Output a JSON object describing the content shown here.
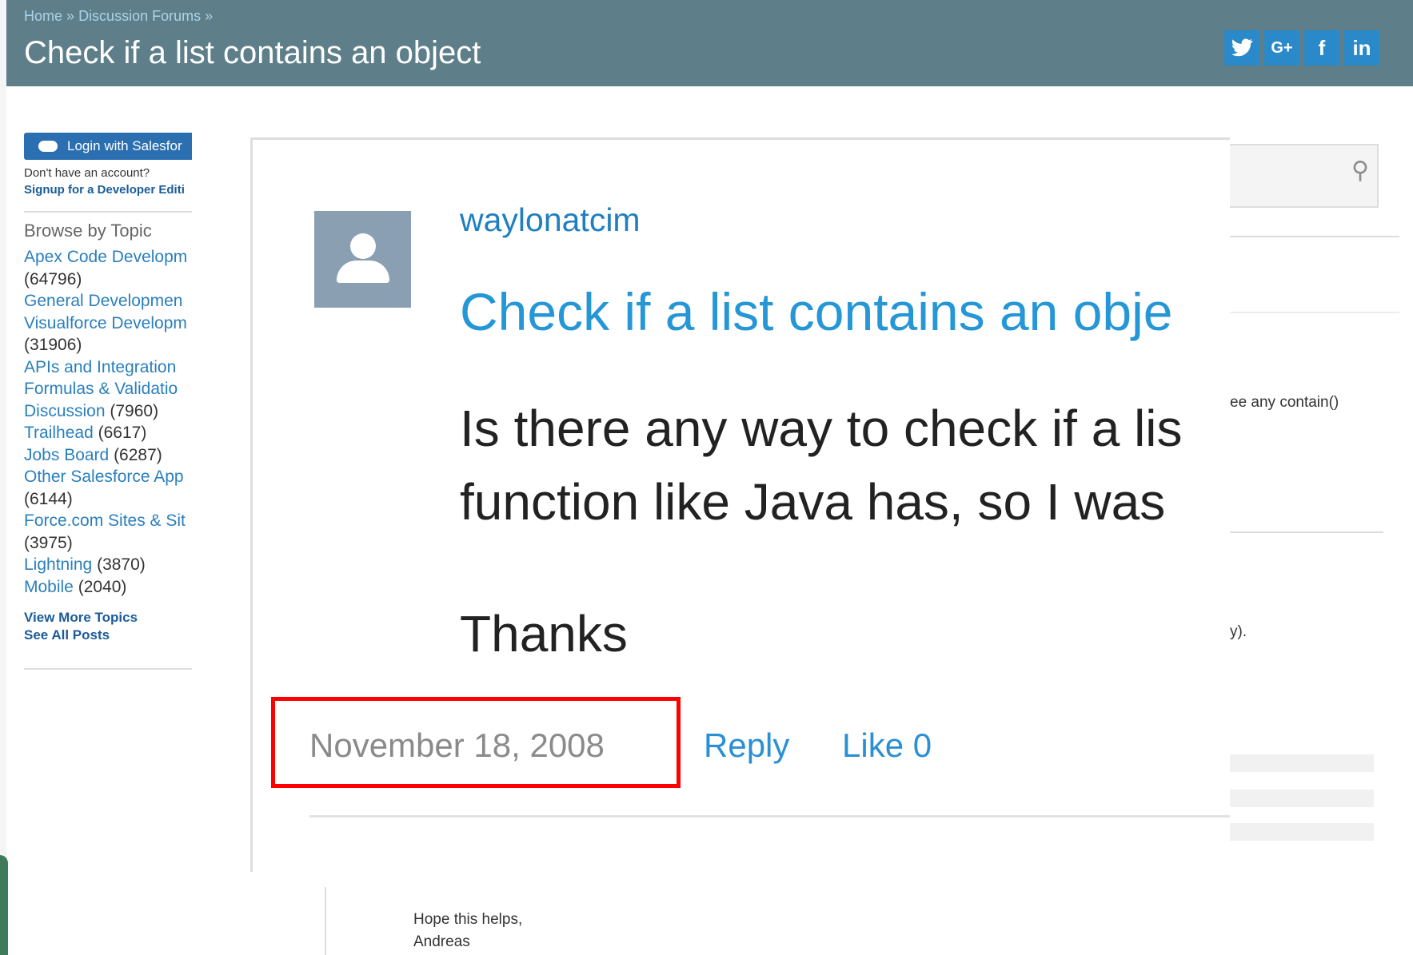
{
  "header": {
    "breadcrumb": [
      "Home",
      "»",
      "Discussion Forums",
      "»"
    ],
    "title": "Check if a list contains an object",
    "social_icons": [
      {
        "name": "twitter-icon",
        "glyph": "🐦"
      },
      {
        "name": "google-plus-icon",
        "glyph": "G+"
      },
      {
        "name": "facebook-icon",
        "glyph": "f"
      },
      {
        "name": "linkedin-icon",
        "glyph": "in"
      }
    ]
  },
  "sidebar": {
    "login_label": "Login with Salesfor",
    "no_account": "Don't have an account?",
    "signup": "Signup for a Developer Editi",
    "browse_title": "Browse by Topic",
    "topic_lines": [
      {
        "name": "Apex Code Developm",
        "count": ""
      },
      {
        "name": "",
        "count": "(64796)"
      },
      {
        "name": "General Developmen",
        "count": ""
      },
      {
        "name": "Visualforce Developm",
        "count": ""
      },
      {
        "name": "",
        "count": "(31906)"
      },
      {
        "name": "APIs and Integration",
        "count": ""
      },
      {
        "name": "Formulas & Validatio",
        "count": ""
      },
      {
        "name": "Discussion",
        "count": " (7960)"
      },
      {
        "name": "Trailhead",
        "count": " (6617)"
      },
      {
        "name": "Jobs Board",
        "count": " (6287)"
      },
      {
        "name": "Other Salesforce App",
        "count": ""
      },
      {
        "name": "",
        "count": "(6144)"
      },
      {
        "name": "Force.com Sites & Sit",
        "count": ""
      },
      {
        "name": "",
        "count": "(3975)"
      },
      {
        "name": "Lightning",
        "count": " (3870)"
      },
      {
        "name": "Mobile",
        "count": " (2040)"
      }
    ],
    "view_more": "View More Topics",
    "see_all": "See All Posts"
  },
  "main": {
    "side_text_1": "ee any contain()",
    "side_text_2": "y).",
    "footer_line_1": "Hope this helps,",
    "footer_line_2": "Andreas"
  },
  "post": {
    "username": "waylonatcim",
    "title": "Check if a list contains an obje",
    "body_line_1": "Is there any way to check if a lis",
    "body_line_2": "function like Java has, so I was",
    "thanks": "Thanks",
    "date": "November 18, 2008",
    "reply": "Reply",
    "like": "Like 0"
  },
  "colors": {
    "header_bg": "#5e7f8a",
    "link_blue": "#2a90d4",
    "highlight": "#ff0000"
  }
}
